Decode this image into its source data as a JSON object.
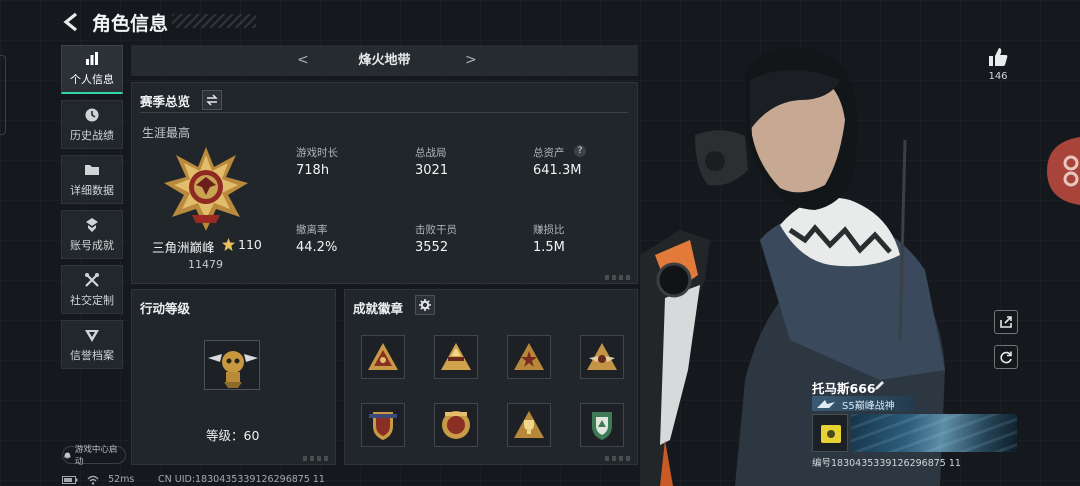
{
  "header": {
    "title": "角色信息"
  },
  "sidebar": {
    "items": [
      {
        "label": "个人信息",
        "active": true
      },
      {
        "label": "历史战绩"
      },
      {
        "label": "详细数据"
      },
      {
        "label": "账号成就"
      },
      {
        "label": "社交定制"
      },
      {
        "label": "信誉档案"
      }
    ],
    "boot_label": "游戏中心启动"
  },
  "mode_bar": {
    "name": "烽火地带",
    "prev": "<",
    "next": ">"
  },
  "season": {
    "title": "赛季总览",
    "career_label": "生涯最高",
    "rank_name": "三角洲巅峰",
    "rank_stars": "110",
    "rank_score": "11479",
    "stats": [
      {
        "label": "游戏时长",
        "value": "718h"
      },
      {
        "label": "总战局",
        "value": "3021"
      },
      {
        "label": "总资产",
        "value": "641.3M"
      },
      {
        "label": "撤离率",
        "value": "44.2%"
      },
      {
        "label": "击败干员",
        "value": "3552"
      },
      {
        "label": "赚损比",
        "value": "1.5M"
      }
    ],
    "help_glyph": "?"
  },
  "action_level": {
    "title": "行动等级",
    "level_text": "等级：60"
  },
  "achievements": {
    "title": "成就徽章",
    "badge_count": 8
  },
  "profile": {
    "like_count": "146",
    "player_name": "托马斯666",
    "player_title": "S5巅峰战神",
    "card_uid": "编号1830435339126296875 11"
  },
  "footer": {
    "status": "52ms",
    "cn_uid": "CN UID:1830435339126296875 11"
  },
  "colors": {
    "accent": "#2fd4a9",
    "panel": "#22272b",
    "background": "#15191d",
    "gold": "#c99a45"
  }
}
